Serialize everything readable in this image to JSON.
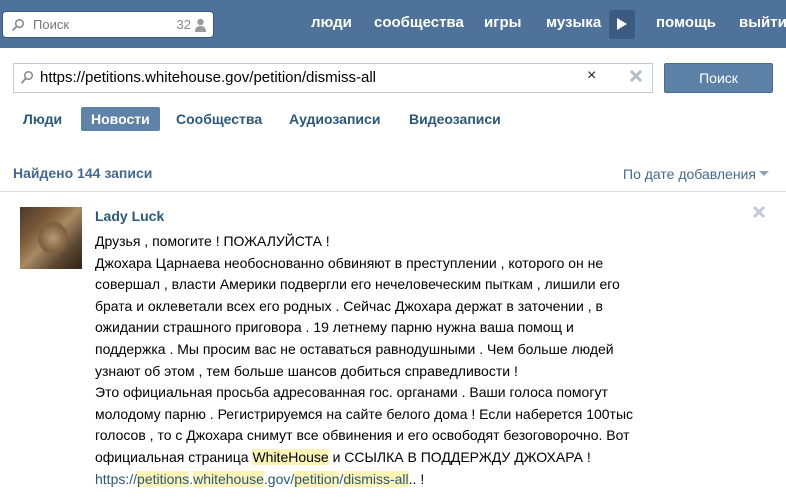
{
  "topbar": {
    "search_placeholder": "Поиск",
    "people_count": "32",
    "nav": [
      "люди",
      "сообщества",
      "игры",
      "музыка",
      "помощь",
      "выйти"
    ]
  },
  "search": {
    "query": "https://petitions.whitehouse.gov/petition/dismiss-all",
    "clear_symbol": "×",
    "button_label": "Поиск"
  },
  "tabs": [
    {
      "label": "Люди",
      "active": false
    },
    {
      "label": "Новости",
      "active": true
    },
    {
      "label": "Сообщества",
      "active": false
    },
    {
      "label": "Аудиозаписи",
      "active": false
    },
    {
      "label": "Видеозаписи",
      "active": false
    }
  ],
  "results": {
    "count_label": "Найдено 144 записи",
    "sort_label": "По дате добавления"
  },
  "post": {
    "author": "Lady Luck",
    "lines": [
      "Друзья , помогите ! ПОЖАЛУЙСТА !",
      "Джохара Царнаева необоснованно обвиняют в преступлении , которого он не",
      "совершал , власти Америки подвергли его нечеловеческим пыткам , лишили его",
      "брата и оклеветали всех его родных . Сейчас Джохара держат в заточении , в",
      "ожидании страшного приговора . 19 летнему парню нужна ваша помощ и",
      "поддержка . Мы просим вас не оставаться равнодушными . Чем больше людей",
      "узнают об этом , тем больше шансов добиться справедливости !",
      "Это официальная просьба адресованная гос. органами . Ваши голоса помогут",
      "молодому парню . Регистрируемся на сайте белого дома ! Если наберется 100тыс",
      "голосов , то с Джохара снимут все обвинения и его освободят безоговорочно. Вот"
    ],
    "line11_before": "официальная страница ",
    "line11_highlight": "WhiteHouse",
    "line11_after": " и ССЫЛКА В ПОДДЕРЖДУ ДЖОХАРА !",
    "link_parts": [
      "https://",
      "petitions",
      ".",
      "whitehouse",
      ".gov/",
      "petition",
      "/",
      "dismiss-all"
    ],
    "link_tail": ".. !"
  },
  "colors": {
    "topbar": "#4e729a",
    "link": "#2b587a",
    "active_tab": "#5e82a8",
    "highlight": "#fbf4b6"
  }
}
